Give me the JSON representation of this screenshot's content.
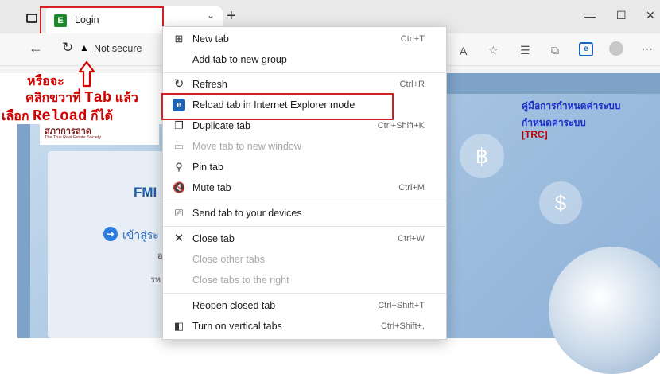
{
  "tab": {
    "title": "Login",
    "favicon_text": "E"
  },
  "window_controls": {
    "minimize": "—",
    "maximize": "☐",
    "close": "✕"
  },
  "toolbar": {
    "not_secure": "Not secure"
  },
  "annotation": {
    "line1": "หรือจะ",
    "line2_prefix": "คลิกขวาที่ ",
    "line2_bold": "Tab",
    "line2_suffix": " แล้ว",
    "line3_prefix": "เลือก ",
    "line3_bold": "Reload",
    "line3_suffix": " กีได้"
  },
  "page": {
    "org_name_th": "สภาการลาด",
    "org_name_en": "The Thai Real Estate Society",
    "fmis_label": "FMI",
    "login_link": "เข้าสู่ระ",
    "login_char1": "อ",
    "login_char2": "รห",
    "right_title_line1": "คู่มือการกำหนดค่าระบบ",
    "right_title_line2": "กำหนดค่าระบบ",
    "right_title_line3": "[TRC]"
  },
  "context_menu": {
    "items": [
      {
        "label": "New tab",
        "shortcut": "Ctrl+T",
        "icon": "new-tab-icon",
        "disabled": false
      },
      {
        "label": "Add tab to new group",
        "shortcut": "",
        "icon": "",
        "disabled": false
      },
      {
        "label": "Refresh",
        "shortcut": "Ctrl+R",
        "icon": "refresh-icon",
        "disabled": false
      },
      {
        "label": "Reload tab in Internet Explorer mode",
        "shortcut": "",
        "icon": "ie-mode-icon",
        "disabled": false
      },
      {
        "label": "Duplicate tab",
        "shortcut": "Ctrl+Shift+K",
        "icon": "duplicate-icon",
        "disabled": false
      },
      {
        "label": "Move tab to new window",
        "shortcut": "",
        "icon": "move-window-icon",
        "disabled": true
      },
      {
        "label": "Pin tab",
        "shortcut": "",
        "icon": "pin-icon",
        "disabled": false
      },
      {
        "label": "Mute tab",
        "shortcut": "Ctrl+M",
        "icon": "mute-icon",
        "disabled": false
      },
      {
        "label": "Send tab to your devices",
        "shortcut": "",
        "icon": "send-devices-icon",
        "disabled": false
      },
      {
        "label": "Close tab",
        "shortcut": "Ctrl+W",
        "icon": "close-icon",
        "disabled": false
      },
      {
        "label": "Close other tabs",
        "shortcut": "",
        "icon": "",
        "disabled": true
      },
      {
        "label": "Close tabs to the right",
        "shortcut": "",
        "icon": "",
        "disabled": true
      },
      {
        "label": "Reopen closed tab",
        "shortcut": "Ctrl+Shift+T",
        "icon": "",
        "disabled": false
      },
      {
        "label": "Turn on vertical tabs",
        "shortcut": "Ctrl+Shift+,",
        "icon": "vertical-tabs-icon",
        "disabled": false
      }
    ]
  },
  "colors": {
    "annotation_red": "#d40000",
    "ie_icon_blue": "#1e64b4",
    "fmis_green": "#2a8a2a"
  }
}
